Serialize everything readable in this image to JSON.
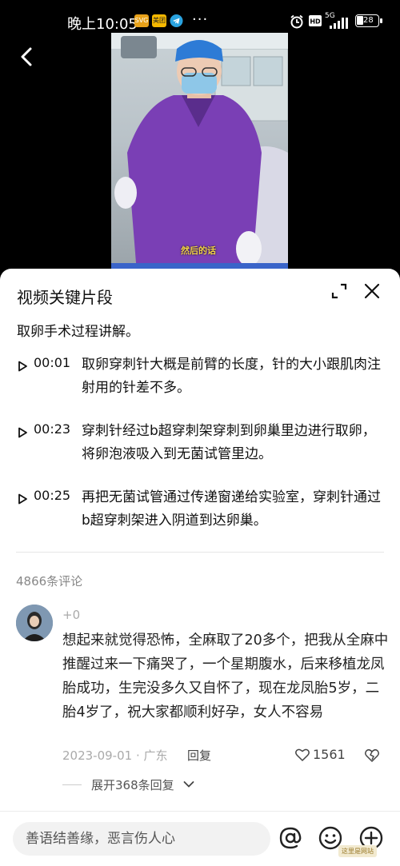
{
  "status_bar": {
    "time": "晚上10:05",
    "badges": [
      "SVG",
      "美团"
    ],
    "dots": "···",
    "network": "5G",
    "battery": "28"
  },
  "video": {
    "subtitle": "然后的话"
  },
  "sheet": {
    "title": "视频关键片段",
    "summary": "取卵手术过程讲解。",
    "segments": [
      {
        "time": "00:01",
        "text": "取卵穿刺针大概是前臂的长度，针的大小跟肌肉注射用的针差不多。"
      },
      {
        "time": "00:23",
        "text": "穿刺针经过b超穿刺架穿刺到卵巢里边进行取卵，将卵泡液吸入到无菌试管里边。"
      },
      {
        "time": "00:25",
        "text": "再把无菌试管通过传递窗递给实验室，穿刺针通过b超穿刺架进入阴道到达卵巢。"
      }
    ]
  },
  "comments": {
    "count_label": "4866条评论",
    "items": [
      {
        "user": "+0",
        "text": "想起来就觉得恐怖，全麻取了20多个，把我从全麻中推醒过来一下痛哭了，一个星期腹水，后来移植龙凤胎成功，生完没多久又自怀了，现在龙凤胎5岁，二胎4岁了，祝大家都顺利好孕，女人不容易",
        "meta": "2023-09-01 · 广东",
        "reply_label": "回复",
        "likes": "1561",
        "expand_label": "展开368条回复"
      }
    ]
  },
  "input": {
    "placeholder": "善语结善缘，恶言伤人心"
  },
  "watermark": "这里是网站",
  "colors": {
    "accent_yellow": "#f3d24a",
    "scrub_purple": "#6a3fb0",
    "text_primary": "#111111",
    "text_muted": "#aaaaaa"
  }
}
